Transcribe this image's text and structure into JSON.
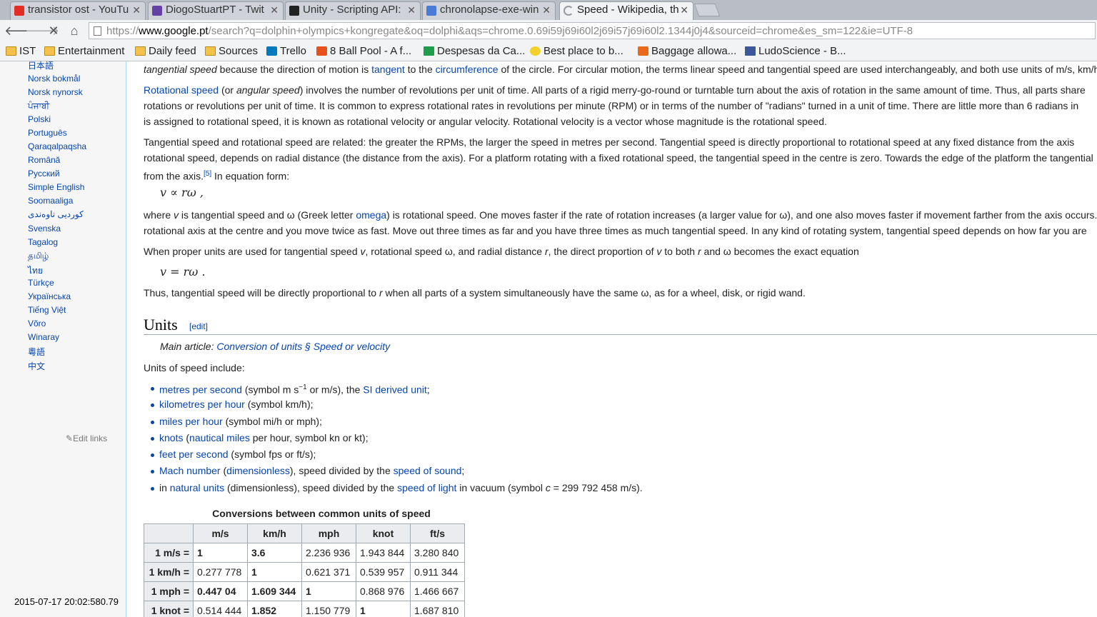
{
  "tabs": [
    {
      "label": "transistor ost - YouTu",
      "icon": "youtube-icon",
      "color": "#e52d27"
    },
    {
      "label": "DiogoStuartPT - Twit",
      "icon": "twitch-icon",
      "color": "#6441a5"
    },
    {
      "label": "Unity - Scripting API:",
      "icon": "unity-icon",
      "color": "#222222"
    },
    {
      "label": "chronolapse-exe-win",
      "icon": "googlecode-icon",
      "color": "#4a7bd6"
    },
    {
      "label": "Speed - Wikipedia, th",
      "icon": "loading-icon",
      "color": "#999999"
    }
  ],
  "address": {
    "prefix": "https://",
    "domain": "www.google.pt",
    "rest": "/search?q=dolphin+olympics+kongregate&oq=dolphi&aqs=chrome.0.69i59j69i60l2j69i57j69i60l2.1344j0j4&sourceid=chrome&es_sm=122&ie=UTF-8"
  },
  "bookmarks": [
    {
      "label": "IST",
      "icon": "folder-icon"
    },
    {
      "label": "Entertainment",
      "icon": "folder-icon"
    },
    {
      "label": "Daily feed",
      "icon": "folder-icon"
    },
    {
      "label": "Sources",
      "icon": "folder-icon"
    },
    {
      "label": "Trello",
      "icon": "trello-icon"
    },
    {
      "label": "8 Ball Pool - A f...",
      "icon": "play-icon"
    },
    {
      "label": "Despesas da Ca...",
      "icon": "sheets-icon"
    },
    {
      "label": "Best place to b...",
      "icon": "smiley-icon"
    },
    {
      "label": "Baggage allowa...",
      "icon": "e-icon"
    },
    {
      "label": "LudoScience - B...",
      "icon": "facebook-icon"
    }
  ],
  "sidebar": {
    "languages": [
      "日本語",
      "Norsk bokmål",
      "Norsk nynorsk",
      "ਪੰਜਾਬੀ",
      "Polski",
      "Português",
      "Qaraqalpaqsha",
      "Română",
      "Русский",
      "Simple English",
      "Soomaaliga",
      "کوردیی ناوەندی",
      "Svenska",
      "Tagalog",
      "தமிழ்",
      "ไทย",
      "Türkçe",
      "Українська",
      "Tiếng Việt",
      "Võro",
      "Winaray",
      "粵語",
      "中文"
    ],
    "edit_links": "Edit links"
  },
  "timestamp": "2015-07-17 20:02:580.79",
  "article": {
    "p0": {
      "a": "tangential speed",
      "b": " because the direction of motion is ",
      "c": "tangent",
      "d": " to the ",
      "e": "circumference",
      "f": " of the circle. For circular motion, the terms linear speed and tangential speed are used interchangeably, and both use units of m/s, km/h, and others."
    },
    "p1": {
      "a": "Rotational speed",
      "b": " (or ",
      "c": "angular speed",
      "d": ") involves the number of revolutions per unit of time. All parts of a rigid merry-go-round or turntable turn about the axis of rotation in the same amount of time. Thus, all parts share",
      "l2": "rotations or revolutions per unit of time. It is common to express rotational rates in revolutions per minute (RPM) or in terms of the number of \"radians\" turned in a unit of time. There are little more than 6 radians in",
      "l3": "is assigned to rotational speed, it is known as rotational velocity or angular velocity. Rotational velocity is a vector whose magnitude is the rotational speed."
    },
    "p2": {
      "l1": "Tangential speed and rotational speed are related: the greater the RPMs, the larger the speed in metres per second. Tangential speed is directly proportional to rotational speed at any fixed distance from the axis",
      "l2": "rotational speed, depends on radial distance (the distance from the axis). For a platform rotating with a fixed rotational speed, the tangential speed in the centre is zero. Towards the edge of the platform the tangential",
      "l3a": "from the axis.",
      "ref": "[5]",
      "l3b": " In equation form:"
    },
    "eq1": "v ∝ rω ,",
    "p3": {
      "a": "where ",
      "v": "v",
      "b": " is tangential speed and ω (Greek letter ",
      "c": "omega",
      "d": ") is rotational speed. One moves faster if the rate of rotation increases (a larger value for ω), and one also moves faster if movement farther from the axis occurs.",
      "l2": "rotational axis at the centre and you move twice as fast. Move out three times as far and you have three times as much tangential speed. In any kind of rotating system, tangential speed depends on how far you are"
    },
    "p4": {
      "a": "When proper units are used for tangential speed ",
      "v": "v",
      "b": ", rotational speed ω, and radial distance ",
      "r": "r",
      "c": ", the direct proportion of ",
      "v2": "v",
      "d": " to both ",
      "r2": "r",
      "e": " and ω becomes the exact equation"
    },
    "eq2": "v = rω .",
    "p5": {
      "a": "Thus, tangential speed will be directly proportional to ",
      "r": "r",
      "b": " when all parts of a system simultaneously have the same ω, as for a wheel, disk, or rigid wand."
    },
    "units_heading": "Units",
    "units_edit": "[edit]",
    "main_article": {
      "label": "Main article: ",
      "link": "Conversion of units § Speed or velocity"
    },
    "units_include": "Units of speed include:",
    "units_list": [
      [
        {
          "t": "metres per second",
          "l": true
        },
        {
          "t": " (symbol m s",
          "l": false
        },
        {
          "t": "−1",
          "sup": true
        },
        {
          "t": " or m/s), the ",
          "l": false
        },
        {
          "t": "SI derived unit",
          "l": true
        },
        {
          "t": ";",
          "l": false
        }
      ],
      [
        {
          "t": "kilometres per hour",
          "l": true
        },
        {
          "t": " (symbol km/h);",
          "l": false
        }
      ],
      [
        {
          "t": "miles per hour",
          "l": true
        },
        {
          "t": " (symbol mi/h or mph);",
          "l": false
        }
      ],
      [
        {
          "t": "knots",
          "l": true
        },
        {
          "t": " (",
          "l": false
        },
        {
          "t": "nautical miles",
          "l": true
        },
        {
          "t": " per hour, symbol kn or kt);",
          "l": false
        }
      ],
      [
        {
          "t": "feet per second",
          "l": true
        },
        {
          "t": " (symbol fps or ft/s);",
          "l": false
        }
      ],
      [
        {
          "t": "Mach number",
          "l": true
        },
        {
          "t": " (",
          "l": false
        },
        {
          "t": "dimensionless",
          "l": true
        },
        {
          "t": "), speed divided by the ",
          "l": false
        },
        {
          "t": "speed of sound",
          "l": true
        },
        {
          "t": ";",
          "l": false
        }
      ],
      [
        {
          "t": "in ",
          "l": false
        },
        {
          "t": "natural units",
          "l": true
        },
        {
          "t": " (dimensionless), speed divided by the ",
          "l": false
        },
        {
          "t": "speed of light",
          "l": true
        },
        {
          "t": " in vacuum (symbol ",
          "l": false
        },
        {
          "t": "c",
          "i": true
        },
        {
          "t": " = 299 792 458 m/s).",
          "l": false
        }
      ]
    ],
    "table": {
      "caption": "Conversions between common units of speed",
      "headers": [
        "",
        "m/s",
        "km/h",
        "mph",
        "knot",
        "ft/s"
      ],
      "rows": [
        {
          "h": "1 m/s =",
          "cells": [
            "1",
            "3.6",
            "2.236 936",
            "1.943 844",
            "3.280 840"
          ],
          "bold": [
            0,
            1
          ]
        },
        {
          "h": "1 km/h =",
          "cells": [
            "0.277 778",
            "1",
            "0.621 371",
            "0.539 957",
            "0.911 344"
          ],
          "bold": [
            1
          ]
        },
        {
          "h": "1 mph =",
          "cells": [
            "0.447 04",
            "1.609 344",
            "1",
            "0.868 976",
            "1.466 667"
          ],
          "bold": [
            0,
            1,
            2
          ]
        },
        {
          "h": "1 knot =",
          "cells": [
            "0.514 444",
            "1.852",
            "1.150 779",
            "1",
            "1.687 810"
          ],
          "bold": [
            1,
            3
          ]
        }
      ]
    }
  }
}
